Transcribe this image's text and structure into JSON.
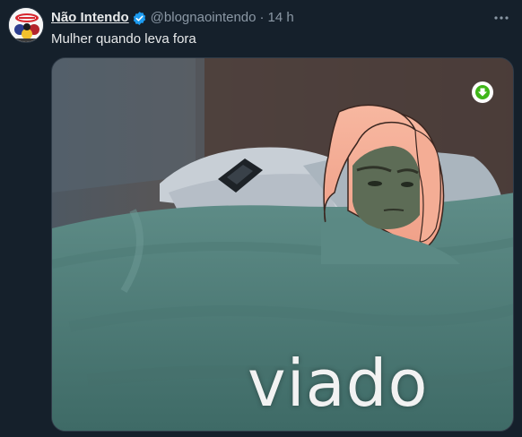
{
  "tweet": {
    "display_name": "Não Intendo",
    "handle": "@blognaointendo",
    "separator": "·",
    "time": "14 h",
    "text": "Mulher quando leva fora",
    "more_label": "•••"
  },
  "media": {
    "caption": "viado"
  },
  "icons": {
    "verified": "verified-badge-icon",
    "more": "more-options-icon",
    "download": "download-arrow-icon"
  },
  "colors": {
    "background": "#15202b",
    "primary_text": "#e7e9ea",
    "secondary_text": "#8b98a5",
    "verified_blue": "#1d9bf0",
    "download_green": "#3fb618"
  }
}
